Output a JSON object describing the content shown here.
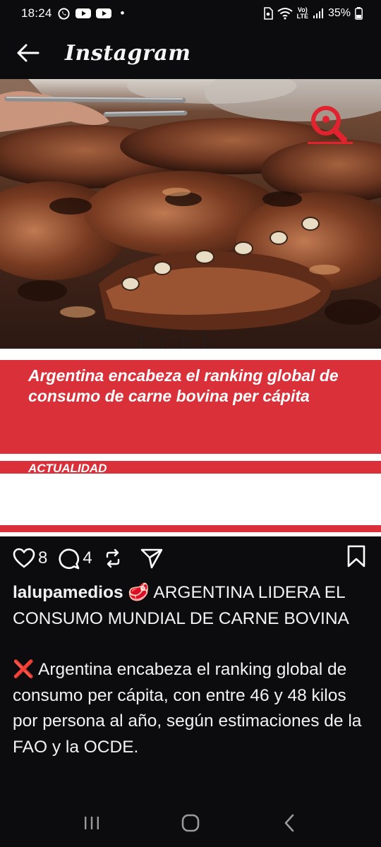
{
  "status_bar": {
    "time": "18:24",
    "dot": "•",
    "network": "Vo)\nLTE",
    "battery": "35%",
    "icons": [
      "whatsapp-icon",
      "youtube-icon",
      "youtube-icon",
      "sim-icon",
      "wifi-icon",
      "signal-icon",
      "battery-icon"
    ]
  },
  "header": {
    "title": "Instagram",
    "back_icon": "arrow-left-icon"
  },
  "post": {
    "headline": "Argentina encabeza el ranking global de consumo de carne bovina per cápita",
    "category": "ACTUALIDAD",
    "brand_logo_icon": "magnifier-pin-logo",
    "accent_color": "#d9303a"
  },
  "actions": {
    "likes": "8",
    "comments": "4",
    "icons": [
      "heart-icon",
      "comment-icon",
      "repost-icon",
      "share-icon",
      "bookmark-icon"
    ]
  },
  "caption": {
    "username": "lalupamedios",
    "emoji": "🥩",
    "line1": "ARGENTINA LIDERA EL CONSUMO MUNDIAL DE CARNE BOVINA",
    "emoji2": "❌",
    "line2": "Argentina encabeza el ranking global de consumo per cápita, con entre 46 y 48 kilos por persona al año, según estimaciones de la FAO y la OCDE."
  },
  "nav": {
    "icons": [
      "recents-icon",
      "home-icon",
      "back-icon"
    ]
  }
}
